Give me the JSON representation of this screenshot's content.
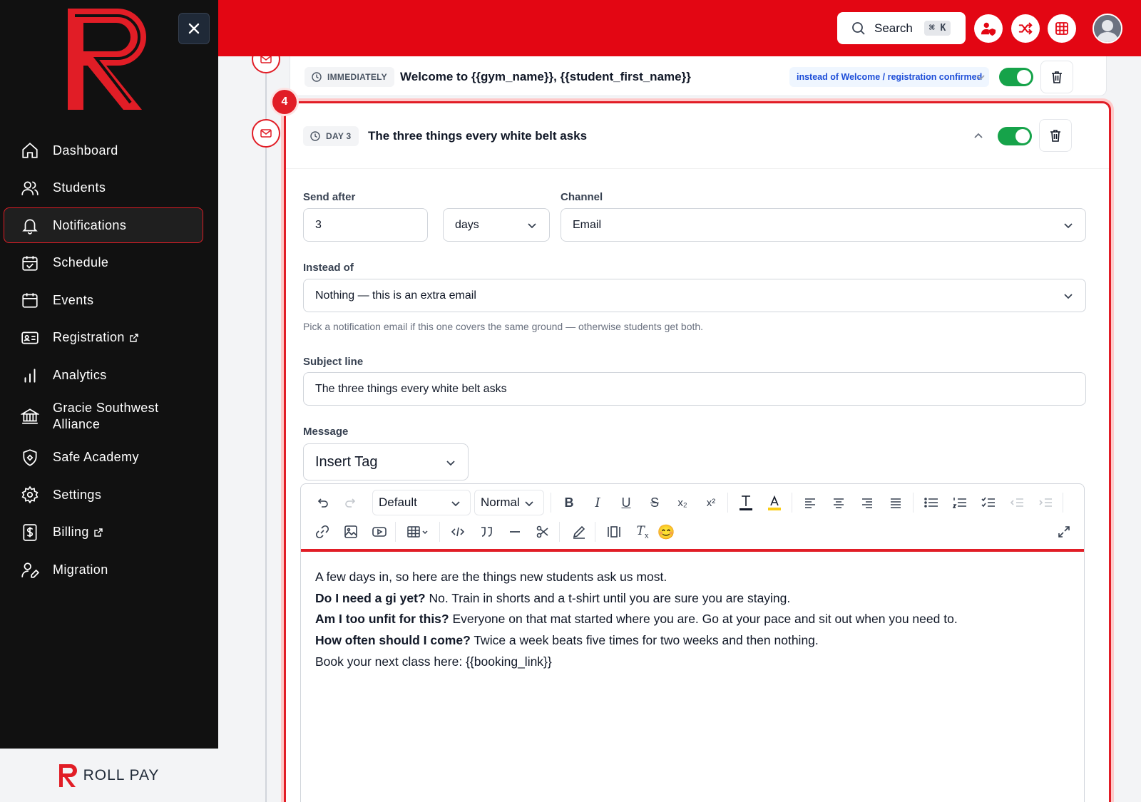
{
  "sidebar": {
    "close_icon": "x-icon",
    "items": [
      {
        "label": "Dashboard",
        "icon": "home-icon"
      },
      {
        "label": "Students",
        "icon": "users-icon"
      },
      {
        "label": "Notifications",
        "icon": "bell-icon",
        "active": true
      },
      {
        "label": "Schedule",
        "icon": "calendar-check-icon"
      },
      {
        "label": "Events",
        "icon": "calendar-icon"
      },
      {
        "label": "Registration",
        "icon": "id-card-icon",
        "external": true
      },
      {
        "label": "Analytics",
        "icon": "bar-chart-icon"
      },
      {
        "label": "Gracie Southwest Alliance",
        "icon": "bank-icon"
      },
      {
        "label": "Safe Academy",
        "icon": "shield-icon"
      },
      {
        "label": "Settings",
        "icon": "gear-icon"
      },
      {
        "label": "Billing",
        "icon": "dollar-doc-icon",
        "external": true
      },
      {
        "label": "Migration",
        "icon": "user-edit-icon"
      }
    ],
    "footer_brand": "ROLL PAY"
  },
  "topbar": {
    "search_label": "Search",
    "search_shortcut": "⌘ K",
    "accent": "#e30613"
  },
  "prev_step": {
    "timing": "IMMEDIATELY",
    "subject": "Welcome to {{gym_name}}, {{student_first_name}}",
    "instead_badge": "instead of Welcome / registration confirmed",
    "enabled": true
  },
  "step": {
    "number": "4",
    "timing": "DAY 3",
    "subject": "The three things every white belt asks",
    "enabled": true,
    "send_after_label": "Send after",
    "send_after_value": "3",
    "unit_value": "days",
    "channel_label": "Channel",
    "channel_value": "Email",
    "instead_label": "Instead of",
    "instead_value": "Nothing — this is an extra email",
    "instead_help": "Pick a notification email if this one covers the same ground — otherwise students get both.",
    "subject_label": "Subject line",
    "subject_value": "The three things every white belt asks",
    "message_label": "Message",
    "insert_tag_label": "Insert Tag"
  },
  "editor": {
    "font_select": "Default",
    "size_select": "Normal",
    "lines": [
      {
        "bold": "",
        "text": "A few days in, so here are the things new students ask us most."
      },
      {
        "bold": "Do I need a gi yet?",
        "text": " No. Train in shorts and a t-shirt until you are sure you are staying."
      },
      {
        "bold": "Am I too unfit for this?",
        "text": " Everyone on that mat started where you are. Go at your pace and sit out when you need to."
      },
      {
        "bold": "How often should I come?",
        "text": " Twice a week beats five times for two weeks and then nothing."
      },
      {
        "bold": "",
        "text": "Book your next class here: {{booking_link}}"
      }
    ]
  }
}
